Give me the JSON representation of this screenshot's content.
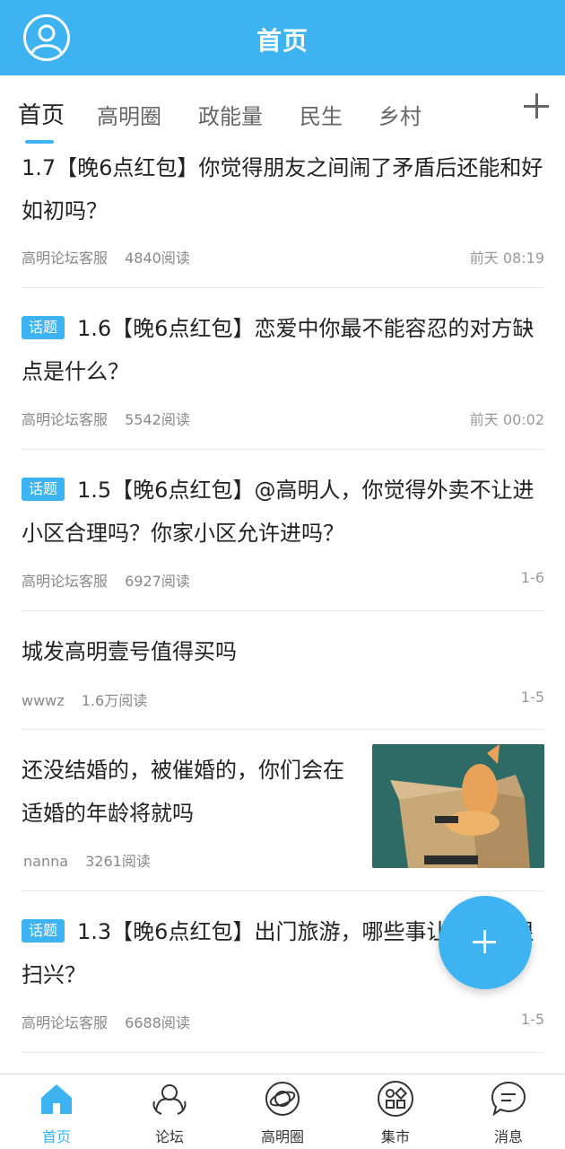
{
  "header": {
    "title": "首页",
    "avatar_icon": "user-circle-icon"
  },
  "tabs": {
    "items": [
      {
        "label": "首页",
        "active": true
      },
      {
        "label": "高明圈"
      },
      {
        "label": "政能量"
      },
      {
        "label": "民生"
      },
      {
        "label": "乡村"
      }
    ],
    "add_icon": "plus-icon"
  },
  "posts": [
    {
      "title": "1.7【晚6点红包】你觉得朋友之间闹了矛盾后还能和好如初吗？",
      "author": "高明论坛客服",
      "reads": "4840阅读",
      "time": "前天 08:19"
    },
    {
      "badge": "话题",
      "title": "1.6【晚6点红包】恋爱中你最不能容忍的对方缺点是什么？",
      "author": "高明论坛客服",
      "reads": "5542阅读",
      "time": "前天 00:02"
    },
    {
      "badge": "话题",
      "title": "1.5【晚6点红包】@高明人，你觉得外卖不让进小区合理吗？你家小区允许进吗？",
      "author": "高明论坛客服",
      "reads": "6927阅读",
      "time": "1-6"
    },
    {
      "title": "城发高明壹号值得买吗",
      "author": "wwwz",
      "reads": "1.6万阅读",
      "time": "1-5"
    },
    {
      "title": "还没结婚的，被催婚的，你们会在适婚的年龄将就吗",
      "author": "nanna",
      "reads": "3261阅读",
      "thumbnail": "cat-in-box-image"
    },
    {
      "badge": "话题",
      "title": "1.3【晚6点红包】出门旅游，哪些事让你觉得很扫兴？",
      "author": "高明论坛客服",
      "reads": "6688阅读",
      "time": "1-5"
    }
  ],
  "fab": {
    "icon": "plus-icon"
  },
  "bottom_nav": {
    "items": [
      {
        "label": "首页",
        "icon": "home-icon",
        "active": true
      },
      {
        "label": "论坛",
        "icon": "forum-people-icon"
      },
      {
        "label": "高明圈",
        "icon": "planet-icon"
      },
      {
        "label": "集市",
        "icon": "market-grid-icon"
      },
      {
        "label": "消息",
        "icon": "chat-bubble-icon"
      }
    ]
  },
  "colors": {
    "accent": "#3db3f1",
    "text": "#222222",
    "meta": "#888888"
  }
}
